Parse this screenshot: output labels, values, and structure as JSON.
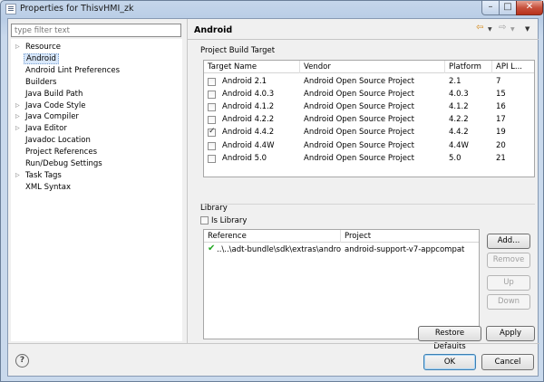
{
  "window": {
    "title": "Properties for ThisvHMI_zk",
    "minimize_glyph": "–",
    "maximize_glyph": "□",
    "close_glyph": "✕"
  },
  "filter": {
    "placeholder": "type filter text",
    "value": ""
  },
  "nav": {
    "items": [
      {
        "label": "Resource",
        "expandable": true,
        "selected": false
      },
      {
        "label": "Android",
        "expandable": false,
        "selected": true
      },
      {
        "label": "Android Lint Preferences",
        "expandable": false,
        "selected": false
      },
      {
        "label": "Builders",
        "expandable": false,
        "selected": false
      },
      {
        "label": "Java Build Path",
        "expandable": false,
        "selected": false
      },
      {
        "label": "Java Code Style",
        "expandable": true,
        "selected": false
      },
      {
        "label": "Java Compiler",
        "expandable": true,
        "selected": false
      },
      {
        "label": "Java Editor",
        "expandable": true,
        "selected": false
      },
      {
        "label": "Javadoc Location",
        "expandable": false,
        "selected": false
      },
      {
        "label": "Project References",
        "expandable": false,
        "selected": false
      },
      {
        "label": "Run/Debug Settings",
        "expandable": false,
        "selected": false
      },
      {
        "label": "Task Tags",
        "expandable": true,
        "selected": false
      },
      {
        "label": "XML Syntax",
        "expandable": false,
        "selected": false
      }
    ]
  },
  "page": {
    "title": "Android",
    "nav_glyphs": {
      "back": "⇦",
      "forward": "⇨",
      "dropdown": "▼",
      "menu": "▼"
    }
  },
  "build_target": {
    "section_label": "Project Build Target",
    "columns": [
      "Target Name",
      "Vendor",
      "Platform",
      "API L..."
    ],
    "rows": [
      {
        "name": "Android 2.1",
        "vendor": "Android Open Source Project",
        "platform": "2.1",
        "api": "7",
        "checked": false
      },
      {
        "name": "Android 4.0.3",
        "vendor": "Android Open Source Project",
        "platform": "4.0.3",
        "api": "15",
        "checked": false
      },
      {
        "name": "Android 4.1.2",
        "vendor": "Android Open Source Project",
        "platform": "4.1.2",
        "api": "16",
        "checked": false
      },
      {
        "name": "Android 4.2.2",
        "vendor": "Android Open Source Project",
        "platform": "4.2.2",
        "api": "17",
        "checked": false
      },
      {
        "name": "Android 4.4.2",
        "vendor": "Android Open Source Project",
        "platform": "4.4.2",
        "api": "19",
        "checked": true
      },
      {
        "name": "Android 4.4W",
        "vendor": "Android Open Source Project",
        "platform": "4.4W",
        "api": "20",
        "checked": false
      },
      {
        "name": "Android 5.0",
        "vendor": "Android Open Source Project",
        "platform": "5.0",
        "api": "21",
        "checked": false
      }
    ]
  },
  "library": {
    "section_label": "Library",
    "is_library_label": "Is Library",
    "is_library_checked": false,
    "columns": [
      "Reference",
      "Project"
    ],
    "rows": [
      {
        "reference": "..\\..\\adt-bundle\\sdk\\extras\\androi...",
        "project": "android-support-v7-appcompat",
        "status_icon": "✔"
      }
    ],
    "buttons": {
      "add": "Add...",
      "remove": "Remove",
      "up": "Up",
      "down": "Down"
    }
  },
  "actions": {
    "restore_defaults": "Restore Defaults",
    "apply": "Apply",
    "ok": "OK",
    "cancel": "Cancel",
    "help_glyph": "?"
  },
  "colors": {
    "selection": "#d9e8fb",
    "check_icon": "#22a722",
    "close_button": "#c7513d"
  }
}
